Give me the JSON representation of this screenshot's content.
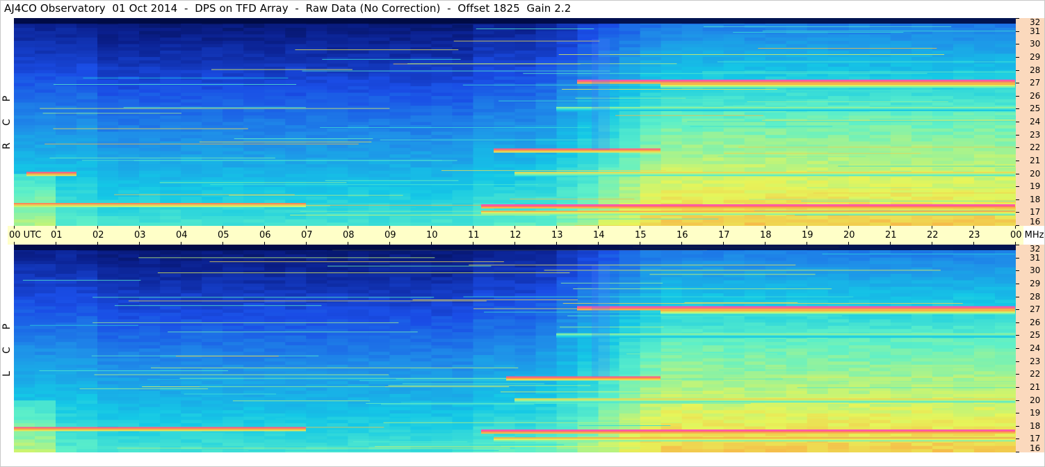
{
  "title": "AJ4CO Observatory  01 Oct 2014  -  DPS on TFD Array  -  Raw Data (No Correction)  -  Offset 1825  Gain 2.2",
  "panels": [
    {
      "id": "top",
      "label": [
        "R",
        "C",
        "P"
      ]
    },
    {
      "id": "bottom",
      "label": [
        "L",
        "C",
        "P"
      ]
    }
  ],
  "time_axis": {
    "labels": [
      "00 UTC",
      "01",
      "02",
      "03",
      "04",
      "05",
      "06",
      "07",
      "08",
      "09",
      "10",
      "11",
      "12",
      "13",
      "14",
      "15",
      "16",
      "17",
      "18",
      "19",
      "20",
      "21",
      "22",
      "23",
      "00 MHz"
    ]
  },
  "freq_axis": {
    "ticks": [
      "32",
      "31",
      "30",
      "29",
      "28",
      "27",
      "26",
      "25",
      "24",
      "23",
      "22",
      "21",
      "20",
      "19",
      "18",
      "17",
      "16"
    ]
  },
  "colors": {
    "background_scale": [
      "#000833",
      "#0a1f8c",
      "#1a4de6",
      "#1f8fe8",
      "#14c8e6",
      "#5ef0c8",
      "#e6f55a",
      "#ff9940",
      "#ff3caa",
      "#ffffff"
    ],
    "time_axis_bg": "#ffffc8",
    "freq_axis_bg": "#fbd9bd"
  },
  "chart_data": [
    {
      "type": "heatmap",
      "title": "AJ4CO Observatory  01 Oct 2014  -  DPS on TFD Array  -  Raw Data (No Correction)  -  Offset 1825  Gain 2.2",
      "xlabel": "UTC",
      "ylabel": "MHz",
      "series_label": "RCP",
      "x_range": [
        0,
        24
      ],
      "y_range": [
        16,
        32
      ],
      "x_ticks": [
        "00",
        "01",
        "02",
        "03",
        "04",
        "05",
        "06",
        "07",
        "08",
        "09",
        "10",
        "11",
        "12",
        "13",
        "14",
        "15",
        "16",
        "17",
        "18",
        "19",
        "20",
        "21",
        "22",
        "23",
        "00"
      ],
      "y_ticks": [
        16,
        17,
        18,
        19,
        20,
        21,
        22,
        23,
        24,
        25,
        26,
        27,
        28,
        29,
        30,
        31,
        32
      ],
      "bright_bands": [
        {
          "freq": 27.1,
          "start": 13.5,
          "end": 24,
          "level": 0.9
        },
        {
          "freq": 26.8,
          "start": 15.5,
          "end": 24,
          "level": 0.75
        },
        {
          "freq": 21.8,
          "start": 11.5,
          "end": 15.5,
          "level": 0.85
        },
        {
          "freq": 17.6,
          "start": 0,
          "end": 7,
          "level": 0.8
        },
        {
          "freq": 17.5,
          "start": 11.2,
          "end": 24,
          "level": 0.9
        },
        {
          "freq": 17.0,
          "start": 11.2,
          "end": 24,
          "level": 0.75
        },
        {
          "freq": 20.0,
          "start": 0.3,
          "end": 1.5,
          "level": 0.85
        },
        {
          "freq": 20.0,
          "start": 12,
          "end": 24,
          "level": 0.7
        },
        {
          "freq": 25.0,
          "start": 13,
          "end": 24,
          "level": 0.6
        }
      ]
    },
    {
      "type": "heatmap",
      "xlabel": "UTC",
      "ylabel": "MHz",
      "series_label": "LCP",
      "x_range": [
        0,
        24
      ],
      "y_range": [
        16,
        32
      ],
      "x_ticks": [
        "00",
        "01",
        "02",
        "03",
        "04",
        "05",
        "06",
        "07",
        "08",
        "09",
        "10",
        "11",
        "12",
        "13",
        "14",
        "15",
        "16",
        "17",
        "18",
        "19",
        "20",
        "21",
        "22",
        "23",
        "00"
      ],
      "y_ticks": [
        16,
        17,
        18,
        19,
        20,
        21,
        22,
        23,
        24,
        25,
        26,
        27,
        28,
        29,
        30,
        31,
        32
      ],
      "bright_bands": [
        {
          "freq": 27.1,
          "start": 13.5,
          "end": 24,
          "level": 0.9
        },
        {
          "freq": 26.8,
          "start": 15.5,
          "end": 24,
          "level": 0.75
        },
        {
          "freq": 21.7,
          "start": 11.8,
          "end": 15.5,
          "level": 0.85
        },
        {
          "freq": 17.8,
          "start": 0,
          "end": 7,
          "level": 0.85
        },
        {
          "freq": 17.6,
          "start": 11.2,
          "end": 24,
          "level": 0.9
        },
        {
          "freq": 17.0,
          "start": 11.5,
          "end": 24,
          "level": 0.75
        },
        {
          "freq": 20.0,
          "start": 12,
          "end": 24,
          "level": 0.7
        },
        {
          "freq": 25.0,
          "start": 13,
          "end": 24,
          "level": 0.6
        }
      ]
    }
  ]
}
